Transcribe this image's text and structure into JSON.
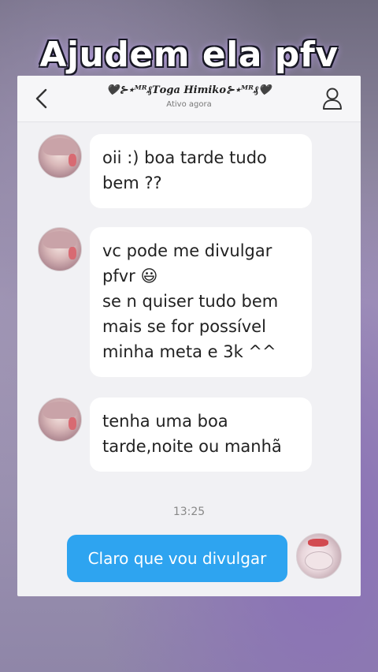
{
  "overlay": {
    "title": "Ajudem ela pfv"
  },
  "header": {
    "name": "🖤⊱⋆ᴹᴿ₰𝑻𝒐𝒈𝒂 𝑯𝒊𝒎𝒊𝒌𝒐⊱⋆ᴹᴿ₰🖤",
    "status": "Ativo agora",
    "back_icon": "chevron-left-icon",
    "profile_icon": "person-icon"
  },
  "messages": [
    {
      "sender": "other",
      "text": "oii :) boa tarde tudo\nbem ??"
    },
    {
      "sender": "other",
      "text": "vc pode me divulgar\npfvr 😃\nse n quiser tudo bem\nmais se for possível\nminha meta e 3k ^^"
    },
    {
      "sender": "other",
      "text": "tenha uma boa\ntarde,noite ou manhã"
    }
  ],
  "timestamp": "13:25",
  "sent": {
    "text": "Claro que vou divulgar"
  },
  "colors": {
    "sent_bubble": "#2ea4f0",
    "received_bubble": "#ffffff",
    "chat_bg": "#f1f1f4"
  }
}
